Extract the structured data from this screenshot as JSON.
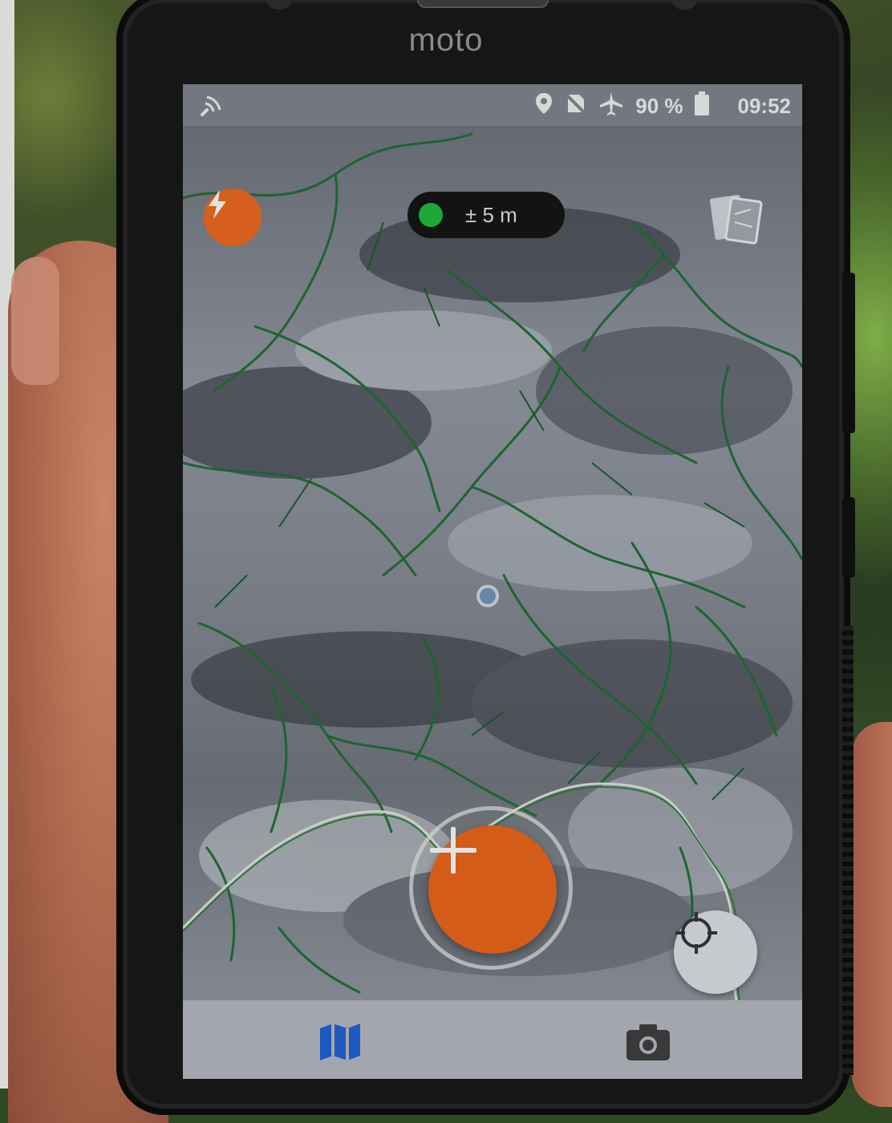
{
  "device": {
    "brand": "moto"
  },
  "status_bar": {
    "battery": "90 %",
    "time": "09:52",
    "icons": [
      "signal-search-icon",
      "location-icon",
      "no-sim-icon",
      "airplane-mode-icon",
      "battery-icon"
    ]
  },
  "map": {
    "gps_accuracy": "± 5 m",
    "gps_status_color": "#1db33b",
    "accent_color": "#e0621a",
    "stream_color": "#1f6b33"
  },
  "controls": {
    "icons": [
      "bolt-icon",
      "layers-icon",
      "plus-icon",
      "crosshair-icon"
    ]
  },
  "bottom_nav": {
    "tabs": [
      {
        "icon": "map-icon",
        "color": "#1f5fcc",
        "active": true
      },
      {
        "icon": "camera-icon",
        "color": "#3d3d3d",
        "active": false
      }
    ]
  }
}
